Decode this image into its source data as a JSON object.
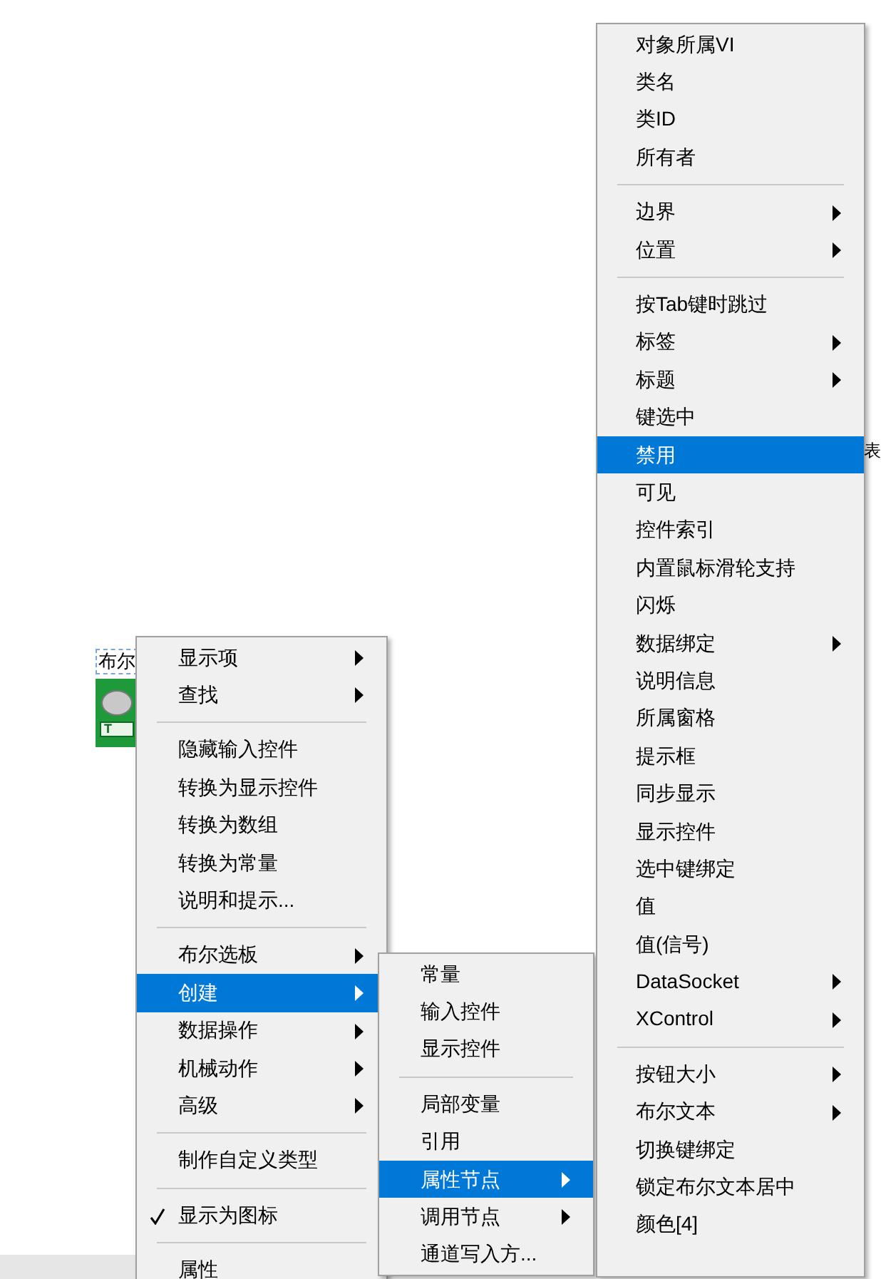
{
  "control": {
    "label": "布尔",
    "button_text": "T"
  },
  "peek_text": "表",
  "context_menu": {
    "items": [
      {
        "kind": "item",
        "label": "显示项",
        "submenu": true,
        "selected": false,
        "checked": false
      },
      {
        "kind": "item",
        "label": "查找",
        "submenu": true,
        "selected": false,
        "checked": false
      },
      {
        "kind": "separator"
      },
      {
        "kind": "item",
        "label": "隐藏输入控件",
        "submenu": false,
        "selected": false,
        "checked": false
      },
      {
        "kind": "item",
        "label": "转换为显示控件",
        "submenu": false,
        "selected": false,
        "checked": false
      },
      {
        "kind": "item",
        "label": "转换为数组",
        "submenu": false,
        "selected": false,
        "checked": false
      },
      {
        "kind": "item",
        "label": "转换为常量",
        "submenu": false,
        "selected": false,
        "checked": false
      },
      {
        "kind": "item",
        "label": "说明和提示...",
        "submenu": false,
        "selected": false,
        "checked": false
      },
      {
        "kind": "separator"
      },
      {
        "kind": "item",
        "label": "布尔选板",
        "submenu": true,
        "selected": false,
        "checked": false
      },
      {
        "kind": "item",
        "label": "创建",
        "submenu": true,
        "selected": true,
        "checked": false
      },
      {
        "kind": "item",
        "label": "数据操作",
        "submenu": true,
        "selected": false,
        "checked": false
      },
      {
        "kind": "item",
        "label": "机械动作",
        "submenu": true,
        "selected": false,
        "checked": false
      },
      {
        "kind": "item",
        "label": "高级",
        "submenu": true,
        "selected": false,
        "checked": false
      },
      {
        "kind": "separator"
      },
      {
        "kind": "item",
        "label": "制作自定义类型",
        "submenu": false,
        "selected": false,
        "checked": false
      },
      {
        "kind": "separator"
      },
      {
        "kind": "item",
        "label": "显示为图标",
        "submenu": false,
        "selected": false,
        "checked": true
      },
      {
        "kind": "separator"
      },
      {
        "kind": "item",
        "label": "属性",
        "submenu": false,
        "selected": false,
        "checked": false
      }
    ]
  },
  "create_submenu": {
    "items": [
      {
        "kind": "item",
        "label": "常量",
        "submenu": false,
        "selected": false
      },
      {
        "kind": "item",
        "label": "输入控件",
        "submenu": false,
        "selected": false
      },
      {
        "kind": "item",
        "label": "显示控件",
        "submenu": false,
        "selected": false
      },
      {
        "kind": "separator"
      },
      {
        "kind": "item",
        "label": "局部变量",
        "submenu": false,
        "selected": false
      },
      {
        "kind": "item",
        "label": "引用",
        "submenu": false,
        "selected": false
      },
      {
        "kind": "item",
        "label": "属性节点",
        "submenu": true,
        "selected": true
      },
      {
        "kind": "item",
        "label": "调用节点",
        "submenu": true,
        "selected": false
      },
      {
        "kind": "item",
        "label": "通道写入方...",
        "submenu": false,
        "selected": false
      }
    ]
  },
  "property_node_submenu": {
    "items": [
      {
        "kind": "item",
        "label": "对象所属VI",
        "submenu": false,
        "selected": false
      },
      {
        "kind": "item",
        "label": "类名",
        "submenu": false,
        "selected": false
      },
      {
        "kind": "item",
        "label": "类ID",
        "submenu": false,
        "selected": false
      },
      {
        "kind": "item",
        "label": "所有者",
        "submenu": false,
        "selected": false
      },
      {
        "kind": "separator"
      },
      {
        "kind": "item",
        "label": "边界",
        "submenu": true,
        "selected": false
      },
      {
        "kind": "item",
        "label": "位置",
        "submenu": true,
        "selected": false
      },
      {
        "kind": "separator"
      },
      {
        "kind": "item",
        "label": "按Tab键时跳过",
        "submenu": false,
        "selected": false
      },
      {
        "kind": "item",
        "label": "标签",
        "submenu": true,
        "selected": false
      },
      {
        "kind": "item",
        "label": "标题",
        "submenu": true,
        "selected": false
      },
      {
        "kind": "item",
        "label": "键选中",
        "submenu": false,
        "selected": false
      },
      {
        "kind": "item",
        "label": "禁用",
        "submenu": false,
        "selected": true
      },
      {
        "kind": "item",
        "label": "可见",
        "submenu": false,
        "selected": false
      },
      {
        "kind": "item",
        "label": "控件索引",
        "submenu": false,
        "selected": false
      },
      {
        "kind": "item",
        "label": "内置鼠标滑轮支持",
        "submenu": false,
        "selected": false
      },
      {
        "kind": "item",
        "label": "闪烁",
        "submenu": false,
        "selected": false
      },
      {
        "kind": "item",
        "label": "数据绑定",
        "submenu": true,
        "selected": false
      },
      {
        "kind": "item",
        "label": "说明信息",
        "submenu": false,
        "selected": false
      },
      {
        "kind": "item",
        "label": "所属窗格",
        "submenu": false,
        "selected": false
      },
      {
        "kind": "item",
        "label": "提示框",
        "submenu": false,
        "selected": false
      },
      {
        "kind": "item",
        "label": "同步显示",
        "submenu": false,
        "selected": false
      },
      {
        "kind": "item",
        "label": "显示控件",
        "submenu": false,
        "selected": false
      },
      {
        "kind": "item",
        "label": "选中键绑定",
        "submenu": false,
        "selected": false
      },
      {
        "kind": "item",
        "label": "值",
        "submenu": false,
        "selected": false
      },
      {
        "kind": "item",
        "label": "值(信号)",
        "submenu": false,
        "selected": false
      },
      {
        "kind": "item",
        "label": "DataSocket",
        "submenu": true,
        "selected": false
      },
      {
        "kind": "item",
        "label": "XControl",
        "submenu": true,
        "selected": false
      },
      {
        "kind": "separator"
      },
      {
        "kind": "item",
        "label": "按钮大小",
        "submenu": true,
        "selected": false
      },
      {
        "kind": "item",
        "label": "布尔文本",
        "submenu": true,
        "selected": false
      },
      {
        "kind": "item",
        "label": "切换键绑定",
        "submenu": false,
        "selected": false
      },
      {
        "kind": "item",
        "label": "锁定布尔文本居中",
        "submenu": false,
        "selected": false
      },
      {
        "kind": "item",
        "label": "颜色[4]",
        "submenu": false,
        "selected": false
      }
    ]
  }
}
